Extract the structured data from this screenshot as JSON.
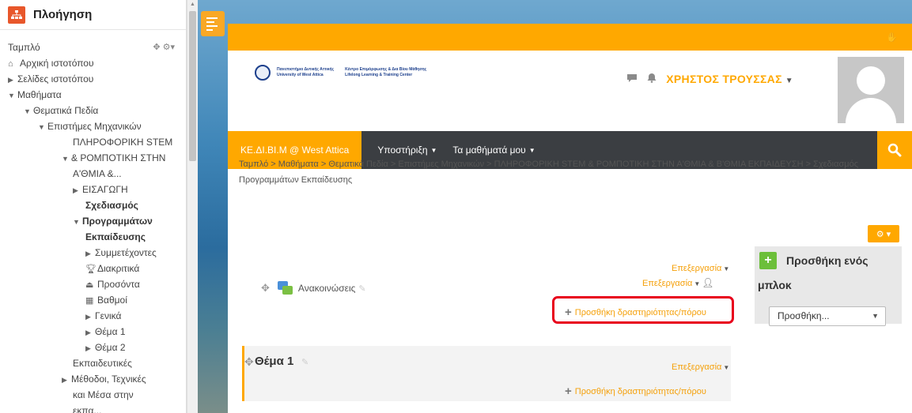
{
  "nav": {
    "title": "Πλοήγηση",
    "items": [
      {
        "label": "Ταμπλό",
        "tools": "✥ ⚙▾"
      },
      {
        "label": "Αρχική ιστοτόπου",
        "icon": "home-icon"
      },
      {
        "label": "Σελίδες ιστοτόπου",
        "icon": "collapsed-arrow-icon"
      },
      {
        "label": "Μαθήματα",
        "icon": "expanded-arrow-icon"
      },
      {
        "label": "Θεματικά Πεδία",
        "icon": "expanded-arrow-icon"
      },
      {
        "label": "Επιστήμες Μηχανικών",
        "icon": "expanded-arrow-icon"
      },
      {
        "label": "ΠΛΗΡΟΦΟΡΙΚΗ STEM"
      },
      {
        "label": "& ΡΟΜΠΟΤΙΚΗ ΣΤΗΝ",
        "icon": "expanded-arrow-icon"
      },
      {
        "label": "Α'ΘΜΙΑ &..."
      },
      {
        "label": "ΕΙΣΑΓΩΓΗ",
        "icon": "collapsed-arrow-icon"
      },
      {
        "label": "Σχεδιασμός"
      },
      {
        "label": "Προγραμμάτων",
        "icon": "expanded-arrow-icon"
      },
      {
        "label": "Εκπαίδευσης"
      },
      {
        "label": "Συμμετέχοντες",
        "icon": "collapsed-arrow-icon"
      },
      {
        "label": "Διακριτικά",
        "icon": "trophy-icon"
      },
      {
        "label": "Προσόντα",
        "icon": "competency-icon"
      },
      {
        "label": "Βαθμοί",
        "icon": "grades-icon"
      },
      {
        "label": "Γενικά",
        "icon": "collapsed-arrow-icon"
      },
      {
        "label": "Θέμα 1",
        "icon": "collapsed-arrow-icon"
      },
      {
        "label": "Θέμα 2",
        "icon": "collapsed-arrow-icon"
      },
      {
        "label": "Εκπαιδευτικές"
      },
      {
        "label": "Μέθοδοι, Τεχνικές",
        "icon": "collapsed-arrow-icon"
      },
      {
        "label": "και Μέσα στην"
      },
      {
        "label": "εκπα..."
      }
    ]
  },
  "header": {
    "brand_line1": "Πανεπιστήμιο Δυτικής Αττικής",
    "brand_line2": "University of West Attica",
    "brand_line3": "Κέντρο Επιμόρφωσης & Δια Βίου Μάθησης",
    "brand_line4": "Lifelong Learning & Training Center",
    "user_name": "ΧΡΗΣΤΟΣ ΤΡΟΥΣΣΑΣ"
  },
  "navbar": {
    "home": "ΚΕ.ΔΙ.ΒΙ.Μ @ West Attica",
    "menu1": "Υποστήριξη",
    "menu2": "Τα μαθήματά μου"
  },
  "breadcrumb": "Ταμπλό > Μαθήματα > Θεματικά Πεδία > Επιστήμες Μηχανικών > ΠΛΗΡΟΦΟΡΙΚΗ STEM & ΡΟΜΠΟΤΙΚΗ ΣΤΗΝ Α'ΘΜΙΑ & Β'ΘΜΙΑ ΕΚΠΑΙΔΕΥΣΗ > Σχεδιασμός Προγραμμάτων Εκπαίδευσης",
  "course": {
    "edit_label": "Επεξεργασία",
    "announcements": "Ανακοινώσεις",
    "add_activity": "Προσθήκη δραστηριότητας/πόρου",
    "topic_title": "Θέμα 1"
  },
  "addblock": {
    "title1": "Προσθήκη ενός",
    "title2": "μπλοκ",
    "select": "Προσθήκη..."
  },
  "colors": {
    "accent": "#ffa800",
    "navbar": "#3b3e42",
    "highlight": "#e8001c"
  }
}
